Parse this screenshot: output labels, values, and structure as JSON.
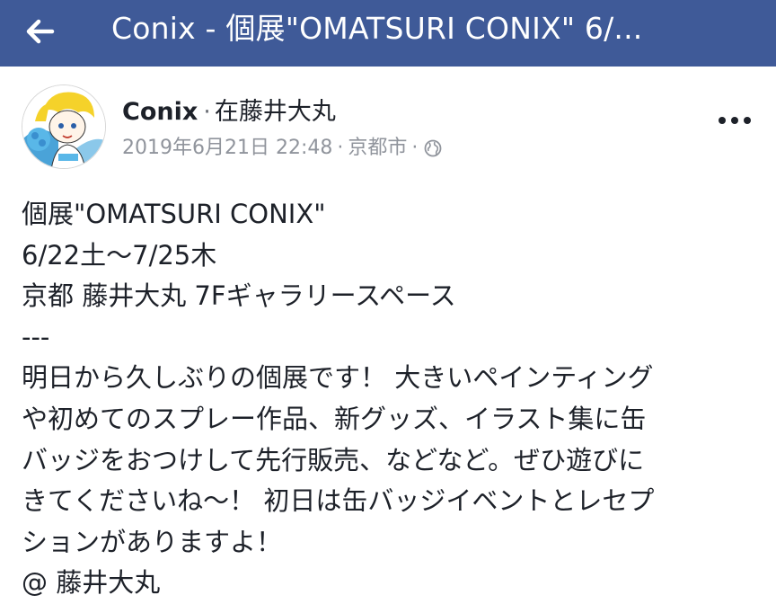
{
  "topbar": {
    "title": "Conix - 個展\"OMATSURI CONIX\" 6/...",
    "bg_color": "#3f5a98",
    "back_icon": "arrow-left-icon"
  },
  "post": {
    "author": "Conix",
    "separator": "·",
    "location_prefix": "在藤井大丸",
    "timestamp": "2019年6月21日 22:48",
    "meta_dot": "·",
    "city": "京都市",
    "meta_dot2": "·",
    "privacy_icon": "globe-icon",
    "more_icon": "more-horizontal-icon",
    "lines": [
      "個展\"OMATSURI CONIX\"",
      "6/22土～7/25木",
      "京都 藤井大丸 7Fギャラリースペース",
      "---",
      "明日から久しぶりの個展です！ 大きいペインティング",
      "や初めてのスプレー作品、新グッズ、イラスト集に缶",
      "バッジをおつけして先行販売、などなど。ぜひ遊びに",
      "きてくださいね～！ 初日は缶バッジイベントとレセプ",
      "ションがありますよ！",
      "@ 藤井大丸"
    ]
  }
}
